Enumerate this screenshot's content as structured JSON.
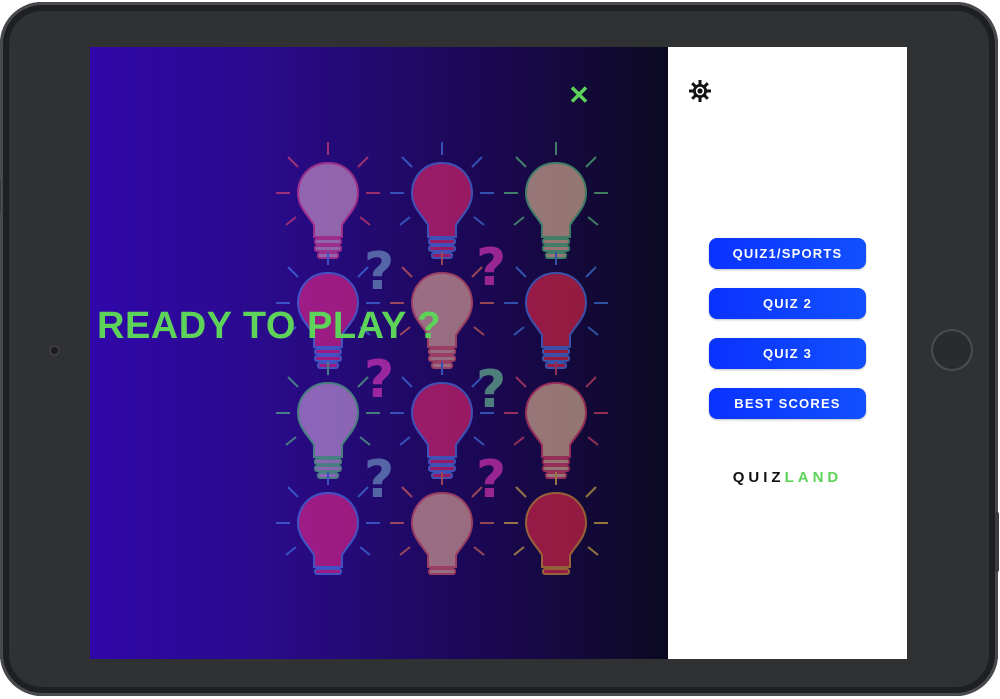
{
  "headline": "U READY TO PLAY ?",
  "close_icon": "close-icon",
  "settings_icon": "gear-icon",
  "menu": {
    "items": [
      {
        "label": "QUIZ1/SPORTS"
      },
      {
        "label": "QUIZ 2"
      },
      {
        "label": "QUIZ 3"
      },
      {
        "label": "BEST SCORES"
      }
    ]
  },
  "logo": {
    "part1": "QUIZ",
    "part2": "LAND"
  },
  "colors": {
    "accent_green": "#5ed35a",
    "button_blue": "#0a32ff",
    "background_start": "#3007a9",
    "background_end": "#0c0a22"
  }
}
